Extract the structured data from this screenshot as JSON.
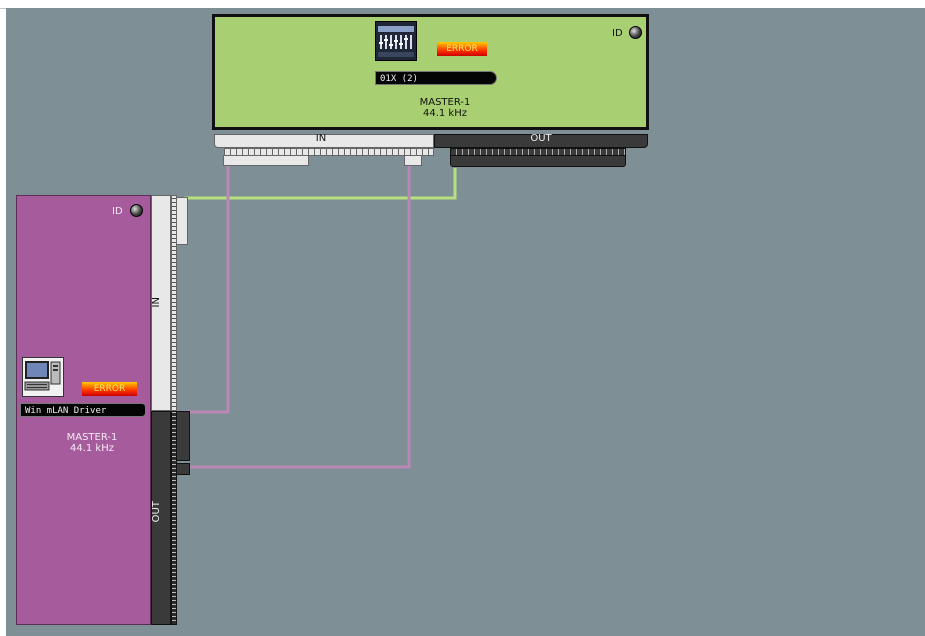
{
  "devices": [
    {
      "id": "green",
      "model": "01X (2)",
      "status": "ERROR",
      "role": "MASTER-1",
      "rate": "44.1 kHz",
      "id_label": "ID",
      "in_label": "IN",
      "out_label": "OUT",
      "color": "#a8d073"
    },
    {
      "id": "purple",
      "model": "Win mLAN Driver",
      "status": "ERROR",
      "role": "MASTER-1",
      "rate": "44.1 kHz",
      "id_label": "ID",
      "in_label": "IN",
      "out_label": "OUT",
      "color": "#a65c9c"
    }
  ],
  "colors": {
    "background": "#7e8f96",
    "wire_green": "#b6e07e",
    "wire_purple": "#bb87b5",
    "error_red": "#ff3300"
  },
  "icons": [
    "mixer-console-icon",
    "computer-icon",
    "id-knob-icon"
  ]
}
